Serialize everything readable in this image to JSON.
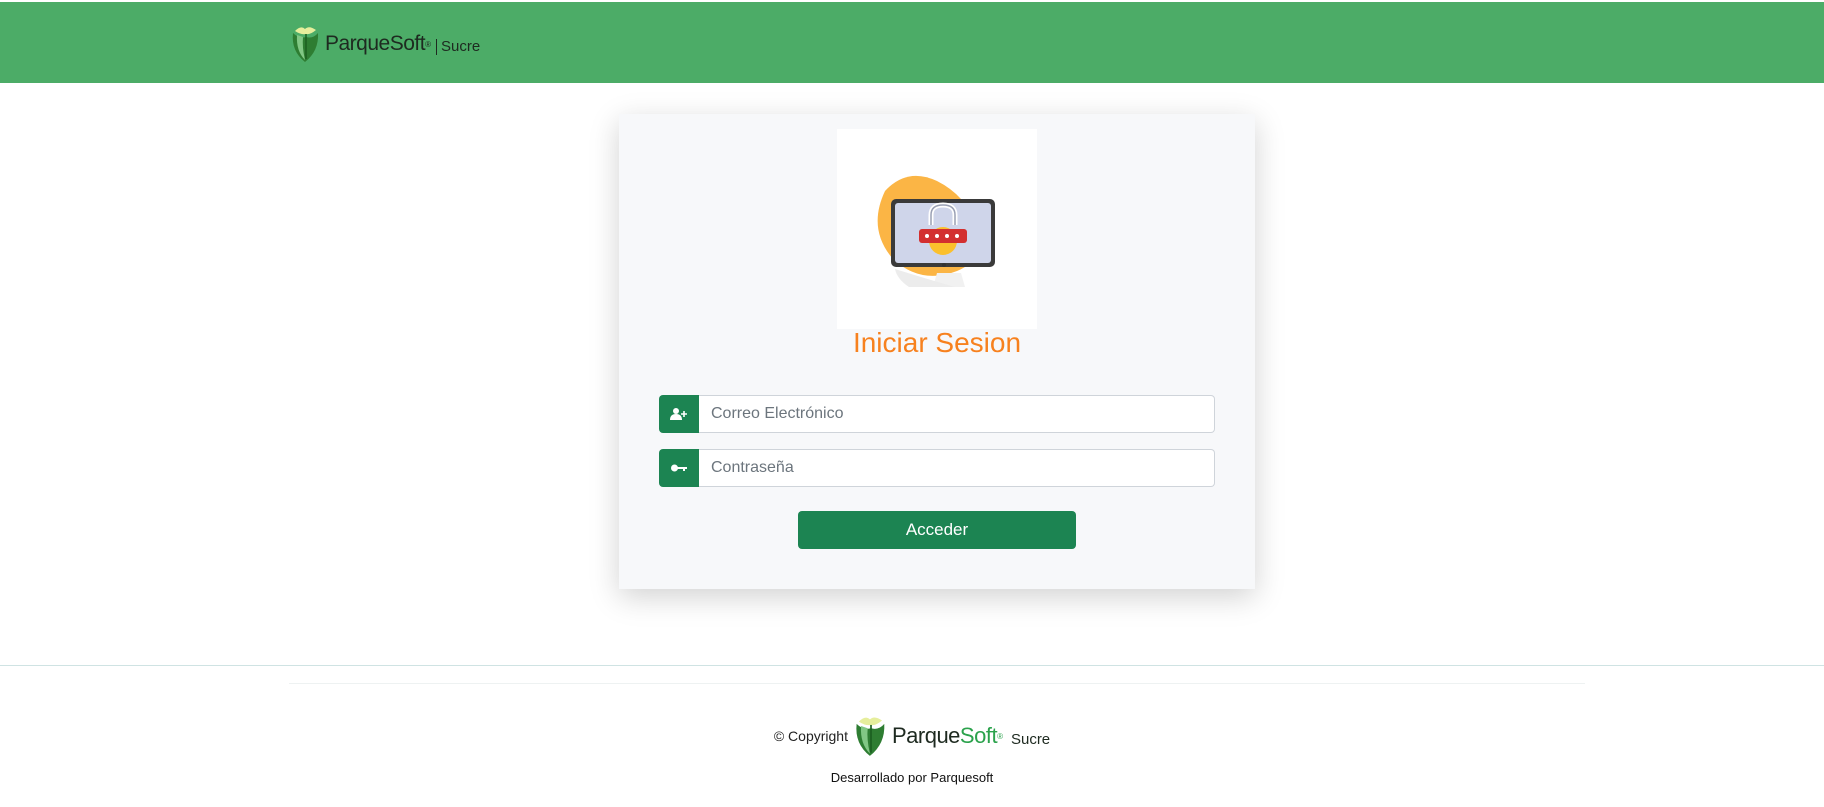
{
  "header": {
    "brand_name": "ParqueSoft",
    "brand_sub": "Sucre",
    "brand_color": "#4cac67"
  },
  "login": {
    "title": "Iniciar Sesion",
    "email_placeholder": "Correo Electrónico",
    "email_icon": "user-plus-icon",
    "password_placeholder": "Contraseña",
    "password_icon": "key-icon",
    "submit_label": "Acceder",
    "title_color": "#f7811e",
    "accent_color": "#1c8452"
  },
  "footer": {
    "copyright": "© Copyright",
    "brand_part1": "Parque",
    "brand_part2": "Soft",
    "brand_sub": "Sucre",
    "developed_by": "Desarrollado por Parquesoft"
  }
}
